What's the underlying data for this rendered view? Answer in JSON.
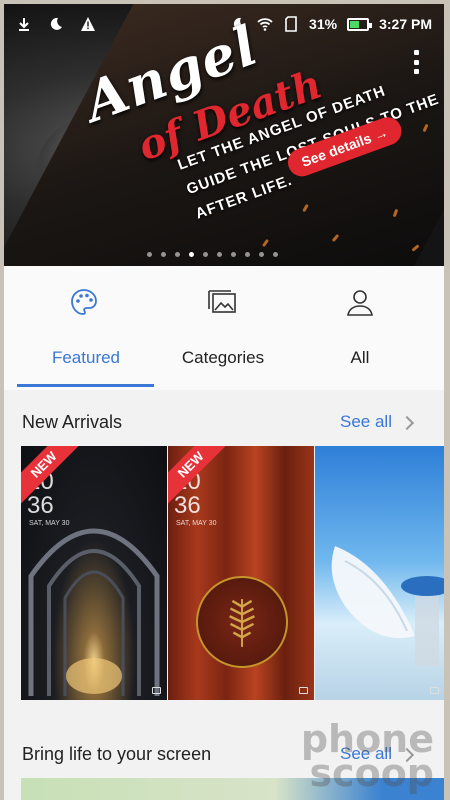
{
  "status_bar": {
    "battery_percent": "31%",
    "time": "3:27 PM",
    "icons": [
      "download-icon",
      "do-not-disturb-icon",
      "warning-icon",
      "do-not-disturb-icon",
      "wifi-icon",
      "sd-card-icon",
      "battery-charging-icon"
    ]
  },
  "hero": {
    "title": "Angel",
    "title_sub": "of Death",
    "tagline": "Let the angel of death guide the lost souls to the after life.",
    "cta_label": "See details",
    "page_count": 10,
    "active_page": 3
  },
  "tabs": [
    {
      "label": "Featured",
      "icon": "palette-icon",
      "active": true
    },
    {
      "label": "Categories",
      "icon": "gallery-icon",
      "active": false
    },
    {
      "label": "All",
      "icon": "person-icon",
      "active": false
    }
  ],
  "new_arrivals": {
    "title": "New Arrivals",
    "see_all": "See all",
    "cards": [
      {
        "badge": "NEW",
        "clock": "10\n36",
        "date": "SAT, MAY 30"
      },
      {
        "badge": "NEW",
        "clock": "10\n36",
        "date": "SAT, MAY 30"
      },
      {
        "badge": "",
        "clock": "",
        "date": ""
      }
    ]
  },
  "bring_life": {
    "title": "Bring life to your screen",
    "see_all": "See all"
  },
  "watermark": {
    "line1": "phone",
    "line2": "scoop"
  },
  "colors": {
    "accent": "#3a77d6",
    "badge_red": "#e8323a",
    "hero_red": "#e0262e"
  }
}
